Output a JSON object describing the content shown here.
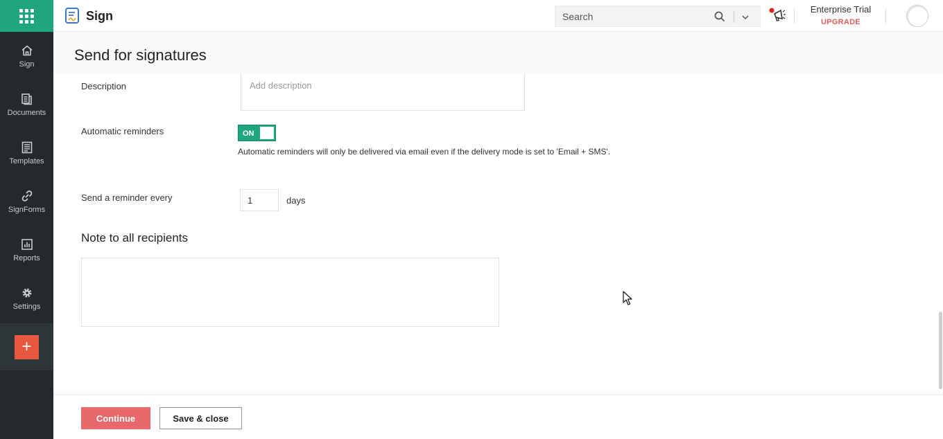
{
  "app": {
    "name": "Sign"
  },
  "sidebar": {
    "items": [
      {
        "label": "Sign",
        "icon": "home-icon"
      },
      {
        "label": "Documents",
        "icon": "documents-icon"
      },
      {
        "label": "Templates",
        "icon": "templates-icon"
      },
      {
        "label": "SignForms",
        "icon": "link-icon"
      },
      {
        "label": "Reports",
        "icon": "reports-icon"
      },
      {
        "label": "Settings",
        "icon": "gear-icon"
      }
    ],
    "add_label": "+"
  },
  "header": {
    "search_placeholder": "Search",
    "plan_name": "Enterprise Trial",
    "upgrade_label": "UPGRADE"
  },
  "page": {
    "title": "Send for signatures",
    "description_label": "Description",
    "description_placeholder": "Add description",
    "reminders_label": "Automatic reminders",
    "reminders_toggle": "ON",
    "reminders_note": "Automatic reminders will only be delivered via email even if the delivery mode is set to 'Email + SMS'.",
    "reminder_every_label": "Send a reminder every",
    "reminder_days_value": "1",
    "reminder_days_unit": "days",
    "note_section_title": "Note to all recipients",
    "note_value": ""
  },
  "footer": {
    "continue_label": "Continue",
    "save_close_label": "Save & close"
  },
  "colors": {
    "sidebar_bg": "#23292d",
    "brand_green": "#1fa67e",
    "accent_red": "#e8573f",
    "continue_red": "#e8676a",
    "upgrade_red": "#e05d5d"
  }
}
